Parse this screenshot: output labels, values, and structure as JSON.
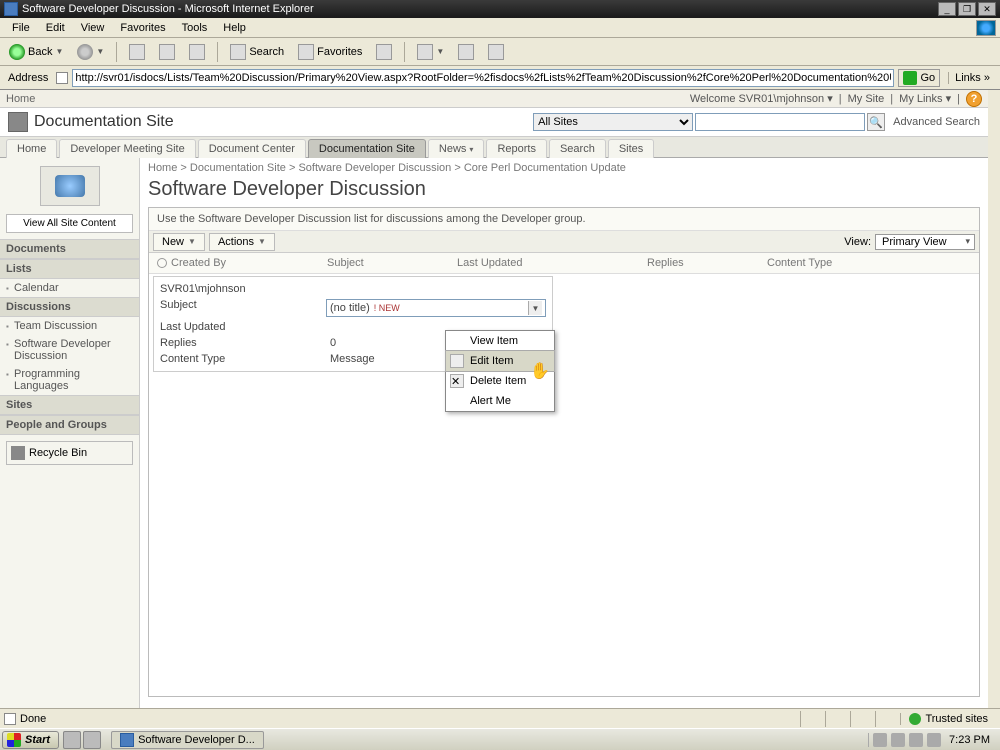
{
  "window": {
    "title": "Software Developer Discussion - Microsoft Internet Explorer"
  },
  "menubar": {
    "file": "File",
    "edit": "Edit",
    "view": "View",
    "favorites": "Favorites",
    "tools": "Tools",
    "help": "Help"
  },
  "toolbar": {
    "back": "Back",
    "search": "Search",
    "favorites": "Favorites"
  },
  "addressbar": {
    "label": "Address",
    "url": "http://svr01/isdocs/Lists/Team%20Discussion/Primary%20View.aspx?RootFolder=%2fisdocs%2fLists%2fTeam%20Discussion%2fCore%20Perl%20Documentation%20Upd",
    "go": "Go",
    "links": "Links"
  },
  "topstrip": {
    "home": "Home",
    "welcome": "Welcome SVR01\\mjohnson",
    "mysite": "My Site",
    "mylinks": "My Links"
  },
  "siteheader": {
    "title": "Documentation Site",
    "scope_option": "All Sites",
    "advanced": "Advanced Search"
  },
  "tabs": {
    "home": "Home",
    "developer_meeting": "Developer Meeting Site",
    "document_center": "Document Center",
    "documentation_site": "Documentation Site",
    "news": "News",
    "reports": "Reports",
    "search": "Search",
    "sites": "Sites"
  },
  "quicklaunch": {
    "view_all": "View All Site Content",
    "documents": "Documents",
    "lists": "Lists",
    "calendar": "Calendar",
    "discussions": "Discussions",
    "team_discussion": "Team Discussion",
    "software_dev": "Software Developer Discussion",
    "programming_lang": "Programming Languages",
    "sites": "Sites",
    "people": "People and Groups",
    "recycle": "Recycle Bin"
  },
  "breadcrumb": {
    "home": "Home",
    "docsite": "Documentation Site",
    "sdd": "Software Developer Discussion",
    "leaf": "Core Perl Documentation Update"
  },
  "page": {
    "title": "Software Developer Discussion",
    "description": "Use the Software Developer Discussion list for discussions among the Developer group."
  },
  "list_toolbar": {
    "new": "New",
    "actions": "Actions",
    "view_label": "View:",
    "view_value": "Primary View"
  },
  "columns": {
    "created_by": "Created By",
    "subject": "Subject",
    "last_updated": "Last Updated",
    "replies": "Replies",
    "content_type": "Content Type"
  },
  "item": {
    "created_by": "SVR01\\mjohnson",
    "subject_label": "Subject",
    "subject_value": "(no title)",
    "subject_new": "! NEW",
    "last_updated_label": "Last Updated",
    "last_updated_value": "",
    "replies_label": "Replies",
    "replies_value": "0",
    "content_type_label": "Content Type",
    "content_type_value": "Message"
  },
  "context_menu": {
    "view": "View Item",
    "edit": "Edit Item",
    "delete": "Delete Item",
    "alert": "Alert Me"
  },
  "statusbar": {
    "status": "Done",
    "zone": "Trusted sites"
  },
  "taskbar": {
    "start": "Start",
    "task": "Software Developer D...",
    "time": "7:23 PM"
  }
}
